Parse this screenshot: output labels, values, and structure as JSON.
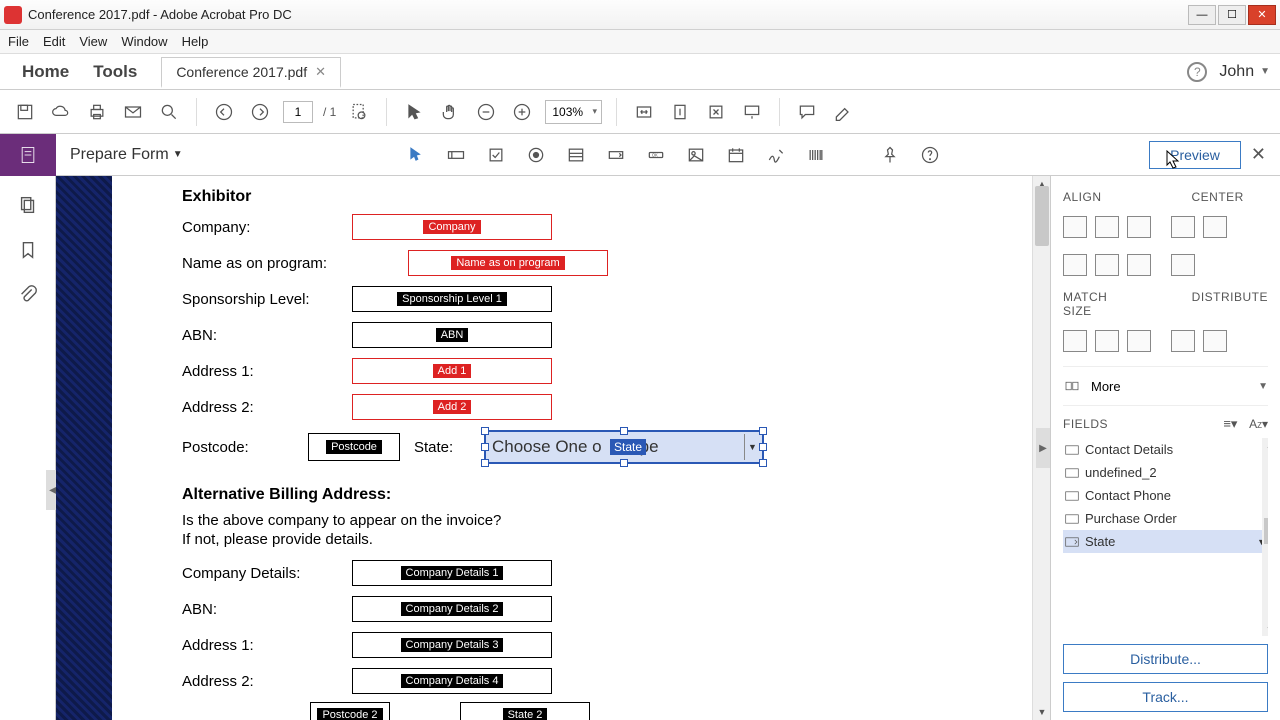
{
  "window": {
    "title": "Conference 2017.pdf - Adobe Acrobat Pro DC"
  },
  "menu": {
    "file": "File",
    "edit": "Edit",
    "view": "View",
    "window": "Window",
    "help": "Help"
  },
  "tabs": {
    "home": "Home",
    "tools": "Tools",
    "doc": "Conference 2017.pdf",
    "user": "John"
  },
  "toolbar": {
    "page_current": "1",
    "page_total": "/ 1",
    "zoom": "103%"
  },
  "formbar": {
    "label": "Prepare Form",
    "preview": "Preview"
  },
  "doc": {
    "heading1": "Exhibitor",
    "company_label": "Company:",
    "company_tag": "Company",
    "program_label": "Name as on program:",
    "program_tag": "Name as on program",
    "sponsor_label": "Sponsorship Level:",
    "sponsor_tag": "Sponsorship Level 1",
    "abn_label": "ABN:",
    "abn_tag": "ABN",
    "addr1_label": "Address 1:",
    "addr1_tag": "Add 1",
    "addr2_label": "Address 2:",
    "addr2_tag": "Add 2",
    "postcode_label": "Postcode:",
    "postcode_tag": "Postcode",
    "state_label": "State:",
    "state_value": "Choose One o",
    "state_tag": "State",
    "state_suffix": "pe",
    "heading2": "Alternative Billing Address:",
    "alt_line1": "Is the above company to appear on the invoice?",
    "alt_line2": "If not, please provide details.",
    "cd_label": "Company Details:",
    "cd1": "Company Details 1",
    "abn2_label": "ABN:",
    "cd2": "Company Details 2",
    "addr1b_label": "Address 1:",
    "cd3": "Company Details 3",
    "addr2b_label": "Address 2:",
    "cd4": "Company Details 4",
    "postcode2_tag": "Postcode 2",
    "state2_tag": "State 2"
  },
  "rpanel": {
    "align": "ALIGN",
    "center": "CENTER",
    "match": "MATCH SIZE",
    "distribute_h": "DISTRIBUTE",
    "more": "More",
    "fields": "FIELDS",
    "items": [
      "Contact Details",
      "undefined_2",
      "Contact Phone",
      "Purchase Order",
      "State"
    ],
    "distribute_btn": "Distribute...",
    "track_btn": "Track..."
  }
}
